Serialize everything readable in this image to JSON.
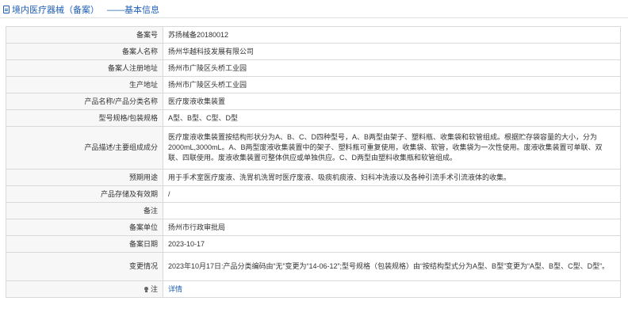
{
  "header": {
    "title": "境内医疗器械（备案）",
    "subtitle": "——基本信息"
  },
  "rows": [
    {
      "label": "备案号",
      "value": "苏扬械备20180012",
      "height": 21
    },
    {
      "label": "备案人名称",
      "value": "扬州华越科技发展有限公司",
      "height": 21
    },
    {
      "label": "备案人注册地址",
      "value": "扬州市广陵区头桥工业园",
      "height": 21
    },
    {
      "label": "生产地址",
      "value": "扬州市广陵区头桥工业园",
      "height": 21
    },
    {
      "label": "产品名称/产品分类名称",
      "value": "医疗废液收集装置",
      "height": 21
    },
    {
      "label": "型号规格/包装规格",
      "value": "A型、B型、C型、D型",
      "height": 21
    },
    {
      "label": "产品描述/主要组成成分",
      "value": "医疗废液收集装置按结构形状分为A、B、C、D四种型号，A、B两型由架子、塑料瓶、收集袋和软管组成。根据贮存袋容量的大小，分为2000mL,3000mL。A、B两型废液收集装置中的架子、塑料瓶可重复使用，收集袋、软管，收集袋为一次性使用。废液收集装置可单联、双联、四联使用。废液收集装置可整体供应或单独供应。C、D两型由塑料收集瓶和软管组成。",
      "height": 54
    },
    {
      "label": "预期用途",
      "value": "用于手术室医疗废液、洗胃机洗胃时医疗废液、吸痰机痰液、妇科冲洗液以及各种引流手术引流液体的收集。",
      "height": 21
    },
    {
      "label": "产品存储及有效期",
      "value": "/",
      "height": 21
    },
    {
      "label": "备注",
      "value": "",
      "height": 21
    },
    {
      "label": "备案单位",
      "value": "扬州市行政审批局",
      "height": 21
    },
    {
      "label": "备案日期",
      "value": "2023-10-17",
      "height": 21
    },
    {
      "label": "变更情况",
      "value": "2023年10月17日:产品分类编码由“无”变更为“14-06-12”;型号规格（包装规格）由“按结构型式分为A型、B型”变更为“A型、B型、C型、D型”。",
      "height": 36
    }
  ],
  "note": {
    "label": "注",
    "value": "详情"
  }
}
